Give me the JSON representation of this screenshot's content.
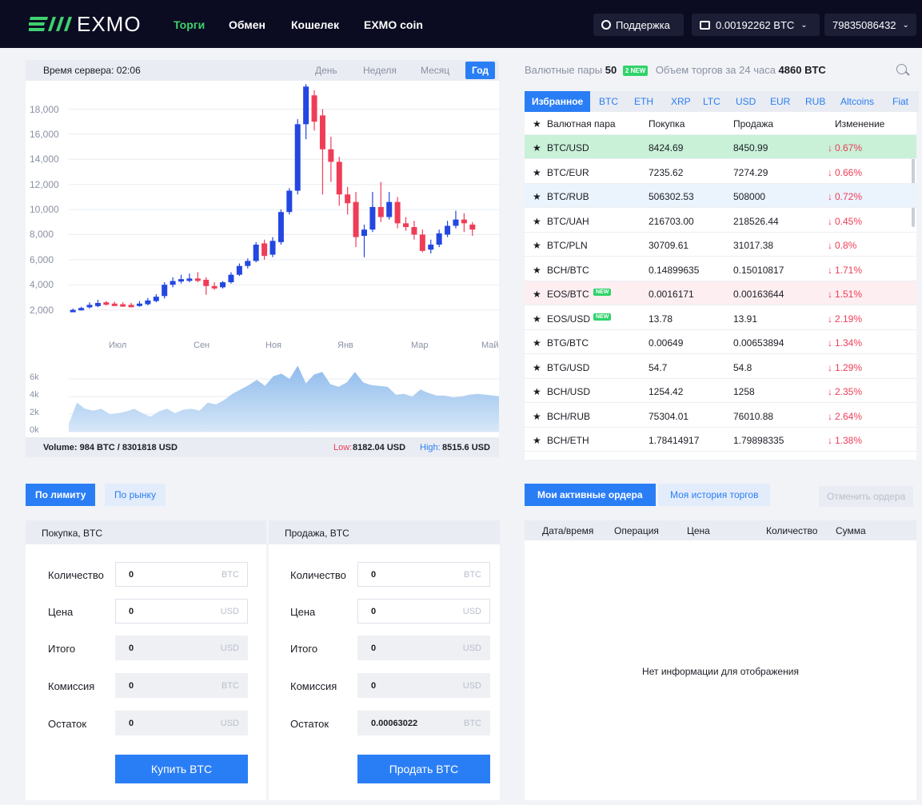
{
  "header": {
    "logo_text": "EXMO",
    "nav": [
      "Торги",
      "Обмен",
      "Кошелек",
      "EXMO coin"
    ],
    "support": "Поддержка",
    "balance": "0.00192262 BTC",
    "account": "79835086432"
  },
  "chart_panel": {
    "server_time": "Время сервера: 02:06",
    "ranges": [
      "День",
      "Неделя",
      "Месяц",
      "Год"
    ],
    "active_range": "Год",
    "volume": "Volume: 984 BTC / 8301818 USD",
    "low_label": "Low:",
    "low_value": "8182.04 USD",
    "high_label": "High:",
    "high_value": "8515.6 USD"
  },
  "chart_data": [
    {
      "type": "candlestick",
      "x_labels": [
        "Июл",
        "Сен",
        "Ноя",
        "Янв",
        "Мар",
        "Май"
      ],
      "y_ticks": [
        "2,000",
        "4,000",
        "6,000",
        "8,000",
        "10,000",
        "12,000",
        "14,000",
        "16,000",
        "18,000"
      ],
      "ylim": [
        0,
        19500
      ],
      "grid": true,
      "up_color": "#2347e0",
      "down_color": "#ef3d57",
      "candles": [
        [
          1900,
          2000,
          2100,
          1850
        ],
        [
          2000,
          2150,
          2250,
          1950
        ],
        [
          2200,
          2400,
          2600,
          2100
        ],
        [
          2300,
          2550,
          2800,
          2200
        ],
        [
          2600,
          2500,
          2700,
          2350
        ],
        [
          2500,
          2450,
          2650,
          2300
        ],
        [
          2450,
          2400,
          2600,
          2250
        ],
        [
          2400,
          2350,
          2550,
          2200
        ],
        [
          2350,
          2500,
          2700,
          2250
        ],
        [
          2450,
          2750,
          2950,
          2350
        ],
        [
          2700,
          3050,
          3250,
          2600
        ],
        [
          3100,
          4000,
          4200,
          2900
        ],
        [
          4000,
          4300,
          4600,
          3800
        ],
        [
          4300,
          4450,
          4800,
          4100
        ],
        [
          4400,
          4500,
          4900,
          4200
        ],
        [
          4500,
          4400,
          5000,
          4200
        ],
        [
          4400,
          3900,
          4600,
          3200
        ],
        [
          3900,
          3800,
          4200,
          3600
        ],
        [
          3800,
          4200,
          4300,
          3700
        ],
        [
          4200,
          4800,
          5000,
          4100
        ],
        [
          4800,
          5500,
          5700,
          4700
        ],
        [
          5500,
          5900,
          6100,
          5300
        ],
        [
          5900,
          7200,
          7400,
          5800
        ],
        [
          7300,
          6300,
          7600,
          6000
        ],
        [
          6400,
          7500,
          7800,
          6200
        ],
        [
          7400,
          9800,
          10000,
          7200
        ],
        [
          9800,
          11500,
          11700,
          9600
        ],
        [
          11500,
          16800,
          17200,
          11200
        ],
        [
          16800,
          19800,
          20000,
          15600
        ],
        [
          19100,
          17000,
          19500,
          16300
        ],
        [
          17500,
          14800,
          18000,
          11200
        ],
        [
          14800,
          13800,
          15800,
          12200
        ],
        [
          13800,
          11200,
          14200,
          10300
        ],
        [
          11200,
          10500,
          11800,
          9600
        ],
        [
          10600,
          7800,
          11400,
          7000
        ],
        [
          7900,
          8400,
          8800,
          6200
        ],
        [
          8400,
          10200,
          11400,
          8200
        ],
        [
          10200,
          9400,
          12200,
          9000
        ],
        [
          9400,
          10600,
          11400,
          9200
        ],
        [
          10600,
          8900,
          11000,
          8500
        ],
        [
          8900,
          8600,
          9400,
          8300
        ],
        [
          8600,
          8000,
          9100,
          7600
        ],
        [
          8000,
          6700,
          8400,
          6600
        ],
        [
          6800,
          7200,
          7600,
          6500
        ],
        [
          7200,
          8100,
          8400,
          7000
        ],
        [
          8000,
          8700,
          9100,
          7800
        ],
        [
          8700,
          9200,
          9900,
          8500
        ],
        [
          9200,
          8900,
          9700,
          8200
        ],
        [
          8800,
          8400,
          9000,
          7900
        ]
      ]
    },
    {
      "type": "area",
      "y_ticks": [
        "0k",
        "2k",
        "4k",
        "6k"
      ],
      "ylim": [
        0,
        8000
      ],
      "fill": "#9ec5ef",
      "values": [
        900,
        3300,
        2600,
        2400,
        2600,
        2000,
        2100,
        2300,
        2600,
        2100,
        1700,
        2300,
        2600,
        2100,
        2500,
        2600,
        2400,
        3300,
        3100,
        3600,
        4300,
        4800,
        5300,
        5900,
        5200,
        6300,
        6600,
        6000,
        7500,
        5500,
        6500,
        6800,
        5400,
        5100,
        5600,
        6800,
        5600,
        5300,
        5200,
        5100,
        4200,
        4300,
        4000,
        4800,
        4400,
        4100,
        4100,
        3900,
        4000,
        4200,
        4300,
        4200,
        4100,
        4000
      ]
    }
  ],
  "pairs_panel": {
    "pairs_label": "Валютные пары",
    "pairs_count": "50",
    "new_badge": "2 NEW",
    "volume_label": "Объем торгов за 24 часа",
    "volume_value": "4860 BTC",
    "tabs": [
      "Избранное",
      "BTC",
      "ETH",
      "XRP",
      "LTC",
      "USD",
      "EUR",
      "RUB",
      "Altcoins",
      "Fiat"
    ],
    "columns": [
      "Валютная пара",
      "Покупка",
      "Продажа",
      "Изменение"
    ],
    "rows": [
      {
        "pair": "BTC/USD",
        "buy": "8424.69",
        "sell": "8450.99",
        "change": "0.67%"
      },
      {
        "pair": "BTC/EUR",
        "buy": "7235.62",
        "sell": "7274.29",
        "change": "0.66%"
      },
      {
        "pair": "BTC/RUB",
        "buy": "506302.53",
        "sell": "508000",
        "change": "0.72%"
      },
      {
        "pair": "BTC/UAH",
        "buy": "216703.00",
        "sell": "218526.44",
        "change": "0.45%"
      },
      {
        "pair": "BTC/PLN",
        "buy": "30709.61",
        "sell": "31017.38",
        "change": "0.8%"
      },
      {
        "pair": "BCH/BTC",
        "buy": "0.14899635",
        "sell": "0.15010817",
        "change": "1.71%"
      },
      {
        "pair": "EOS/BTC",
        "buy": "0.0016171",
        "sell": "0.00163644",
        "change": "1.51%",
        "new": "NEW"
      },
      {
        "pair": "EOS/USD",
        "buy": "13.78",
        "sell": "13.91",
        "change": "2.19%",
        "new": "NEW"
      },
      {
        "pair": "BTG/BTC",
        "buy": "0.00649",
        "sell": "0.00653894",
        "change": "1.34%"
      },
      {
        "pair": "BTG/USD",
        "buy": "54.7",
        "sell": "54.8",
        "change": "1.29%"
      },
      {
        "pair": "BCH/USD",
        "buy": "1254.42",
        "sell": "1258",
        "change": "2.35%"
      },
      {
        "pair": "BCH/RUB",
        "buy": "75304.01",
        "sell": "76010.88",
        "change": "2.64%"
      },
      {
        "pair": "BCH/ETH",
        "buy": "1.78414917",
        "sell": "1.79898335",
        "change": "1.38%"
      }
    ]
  },
  "order_form": {
    "tabs": [
      "По лимиту",
      "По рынку"
    ],
    "buy": {
      "title": "Покупка, BTC",
      "fields": [
        {
          "label": "Количество",
          "value": "0",
          "unit": "BTC"
        },
        {
          "label": "Цена",
          "value": "0",
          "unit": "USD"
        },
        {
          "label": "Итого",
          "value": "0",
          "unit": "USD"
        },
        {
          "label": "Комиссия",
          "value": "0",
          "unit": "BTC"
        },
        {
          "label": "Остаток",
          "value": "0",
          "unit": "USD"
        }
      ],
      "button": "Купить BTC"
    },
    "sell": {
      "title": "Продажа, BTC",
      "fields": [
        {
          "label": "Количество",
          "value": "0",
          "unit": "BTC"
        },
        {
          "label": "Цена",
          "value": "0",
          "unit": "USD"
        },
        {
          "label": "Итого",
          "value": "0",
          "unit": "USD"
        },
        {
          "label": "Комиссия",
          "value": "0",
          "unit": "USD"
        },
        {
          "label": "Остаток",
          "value": "0.00063022",
          "unit": "BTC"
        }
      ],
      "button": "Продать BTC"
    }
  },
  "orders_panel": {
    "tabs": [
      "Мои активные ордера",
      "Моя история торгов"
    ],
    "cancel_button": "Отменить ордера",
    "columns": [
      "Дата/время",
      "Операция",
      "Цена",
      "Количество",
      "Сумма"
    ],
    "empty_text": "Нет информации для отображения"
  }
}
